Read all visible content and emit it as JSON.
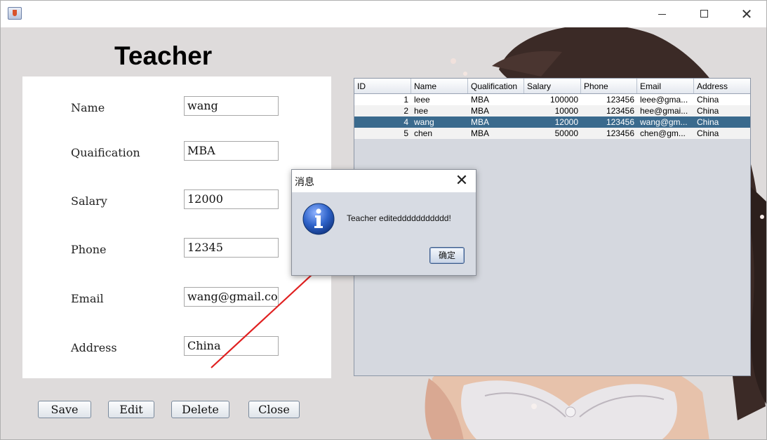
{
  "window": {
    "controls": {
      "minimize": "minimize",
      "maximize": "maximize",
      "close": "✕"
    }
  },
  "form": {
    "title": "Teacher",
    "fields": [
      {
        "label": "Name",
        "value": "wang"
      },
      {
        "label": "Quaification",
        "value": "MBA"
      },
      {
        "label": "Salary",
        "value": "12000"
      },
      {
        "label": "Phone",
        "value": "12345"
      },
      {
        "label": "Email",
        "value": "wang@gmail.com"
      },
      {
        "label": "Address",
        "value": "China"
      }
    ],
    "buttons": {
      "save": "Save",
      "edit": "Edit",
      "delete": "Delete",
      "close": "Close"
    }
  },
  "table": {
    "columns": [
      "ID",
      "Name",
      "Qualification",
      "Salary",
      "Phone",
      "Email",
      "Address"
    ],
    "rows": [
      [
        "1",
        "leee",
        "MBA",
        "100000",
        "123456",
        "leee@gma...",
        "China"
      ],
      [
        "2",
        "hee",
        "MBA",
        "10000",
        "123456",
        "hee@gmai...",
        "China"
      ],
      [
        "4",
        "wang",
        "MBA",
        "12000",
        "123456",
        "wang@gm...",
        "China"
      ],
      [
        "5",
        "chen",
        "MBA",
        "50000",
        "123456",
        "chen@gm...",
        "China"
      ]
    ],
    "selected_row_index": 2
  },
  "dialog": {
    "title": "消息",
    "close": "✕",
    "message": "Teacher editeddddddddddd!",
    "ok": "确定",
    "icon": "info-icon"
  },
  "colors": {
    "selection": "#3a6a8d",
    "arrow": "#e02020",
    "info_blue": "#2f63c9"
  }
}
